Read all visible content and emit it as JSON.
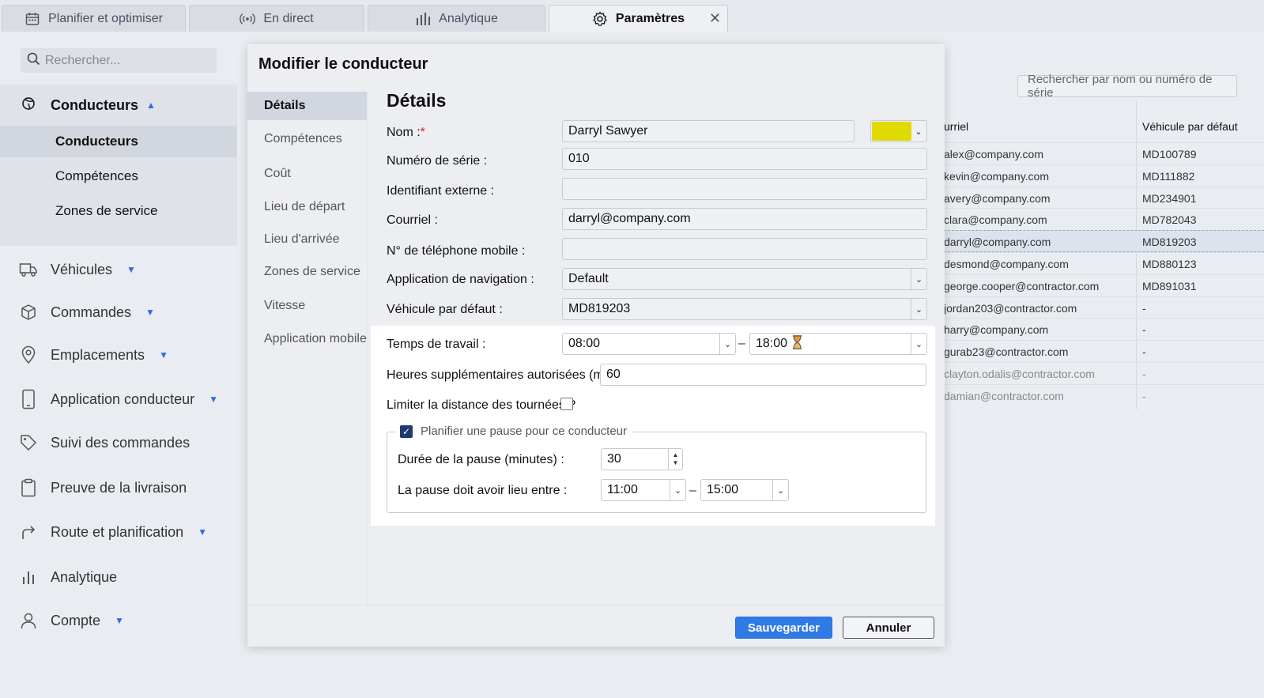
{
  "tabs": [
    {
      "label": "Planifier et optimiser",
      "icon": "calendar-icon"
    },
    {
      "label": "En direct",
      "icon": "broadcast-icon"
    },
    {
      "label": "Analytique",
      "icon": "bar-chart-icon"
    },
    {
      "label": "Paramètres",
      "icon": "gear-icon",
      "active": true
    }
  ],
  "sidebar": {
    "search_placeholder": "Rechercher...",
    "drivers": {
      "label": "Conducteurs",
      "items": [
        "Conducteurs",
        "Compétences",
        "Zones de service"
      ],
      "selected": "Conducteurs"
    },
    "items": [
      {
        "label": "Véhicules",
        "icon": "truck-icon",
        "dropdown": true
      },
      {
        "label": "Commandes",
        "icon": "box-icon",
        "dropdown": true
      },
      {
        "label": "Emplacements",
        "icon": "location-pin-icon",
        "dropdown": true
      },
      {
        "label": "Application conducteur",
        "icon": "phone-icon",
        "dropdown": true
      },
      {
        "label": "Suivi des commandes",
        "icon": "tag-icon",
        "dropdown": false
      },
      {
        "label": "Preuve de la livraison",
        "icon": "clipboard-icon",
        "dropdown": false
      },
      {
        "label": "Route et planification",
        "icon": "route-arrow-icon",
        "dropdown": true
      },
      {
        "label": "Analytique",
        "icon": "bar-chart-icon",
        "dropdown": false
      },
      {
        "label": "Compte",
        "icon": "user-icon",
        "dropdown": true
      }
    ]
  },
  "background_table": {
    "search_placeholder": "Rechercher par nom ou numéro de série",
    "headers": [
      "urriel",
      "Véhicule par défaut"
    ],
    "rows": [
      [
        "alex@company.com",
        "MD100789"
      ],
      [
        "kevin@company.com",
        "MD111882"
      ],
      [
        "avery@company.com",
        "MD234901"
      ],
      [
        "clara@company.com",
        "MD782043"
      ],
      [
        "darryl@company.com",
        "MD819203"
      ],
      [
        "desmond@company.com",
        "MD880123"
      ],
      [
        "george.cooper@contractor.com",
        "MD891031"
      ],
      [
        "jordan203@contractor.com",
        "-"
      ],
      [
        "harry@company.com",
        "-"
      ],
      [
        "gurab23@contractor.com",
        "-"
      ],
      [
        "clayton.odalis@contractor.com",
        "-"
      ],
      [
        "damian@contractor.com",
        "-"
      ]
    ],
    "highlighted_row": 4
  },
  "modal": {
    "title": "Modifier le conducteur",
    "nav": [
      "Détails",
      "Compétences",
      "Coût",
      "Lieu de départ",
      "Lieu d'arrivée",
      "Zones de service",
      "Vitesse",
      "Application mobile"
    ],
    "nav_selected": "Détails",
    "section_title": "Détails",
    "fields": {
      "name": {
        "label": "Nom :",
        "required_mark": "*",
        "value": "Darryl Sawyer"
      },
      "serial": {
        "label": "Numéro de série :",
        "value": "010"
      },
      "external_id": {
        "label": "Identifiant externe :",
        "value": ""
      },
      "email": {
        "label": "Courriel :",
        "value": "darryl@company.com"
      },
      "mobile": {
        "label": "N° de téléphone mobile :",
        "value": ""
      },
      "nav_app": {
        "label": "Application de navigation :",
        "value": "Default"
      },
      "default_vehicle": {
        "label": "Véhicule par défaut :",
        "value": "MD819203"
      },
      "work_time": {
        "label": "Temps de travail :",
        "start": "08:00",
        "end": "18:00",
        "separator": "–"
      },
      "overtime": {
        "label": "Heures supplémentaires autorisées (min) :",
        "value": "60"
      },
      "limit_distance": {
        "label": "Limiter la distance des tournées ?",
        "checked": false
      },
      "break": {
        "legend": "Planifier une pause pour ce conducteur",
        "checked": true,
        "duration_label": "Durée de la pause (minutes) :",
        "duration": "30",
        "window_label": "La pause doit avoir lieu entre :",
        "window_start": "11:00",
        "window_end": "15:00",
        "separator": "–"
      }
    },
    "driver_color": "#e1da00",
    "buttons": {
      "save": "Sauvegarder",
      "cancel": "Annuler"
    }
  }
}
